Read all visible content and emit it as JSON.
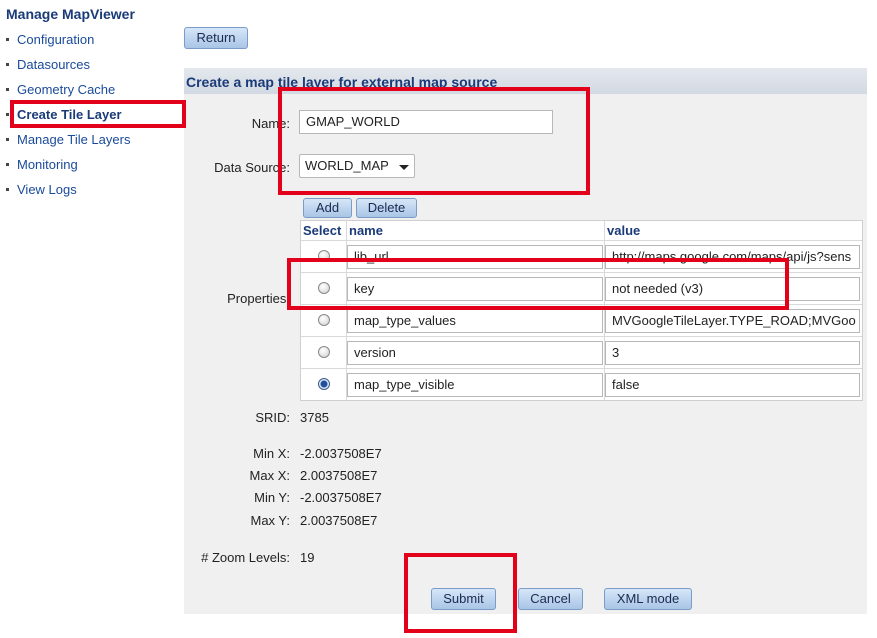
{
  "sidebar": {
    "title": "Manage MapViewer",
    "items": [
      {
        "label": "Configuration"
      },
      {
        "label": "Datasources"
      },
      {
        "label": "Geometry Cache"
      },
      {
        "label": "Create Tile Layer"
      },
      {
        "label": "Manage Tile Layers"
      },
      {
        "label": "Monitoring"
      },
      {
        "label": "View Logs"
      }
    ],
    "active_item": "Create Tile Layer"
  },
  "toolbar": {
    "return_label": "Return"
  },
  "form": {
    "title": "Create a map tile layer for external map source",
    "name_label": "Name:",
    "name_value": "GMAP_WORLD",
    "datasource_label": "Data Source:",
    "datasource_value": "WORLD_MAP",
    "properties_label": "Properties:",
    "add_label": "Add",
    "delete_label": "Delete",
    "grid_headers": {
      "select": "Select",
      "name": "name",
      "value": "value"
    },
    "properties": [
      {
        "name": "lib_url",
        "value": "http://maps.google.com/maps/api/js?sens",
        "selected": false
      },
      {
        "name": "key",
        "value": "not needed (v3)",
        "selected": false
      },
      {
        "name": "map_type_values",
        "value": "MVGoogleTileLayer.TYPE_ROAD;MVGoo",
        "selected": false
      },
      {
        "name": "version",
        "value": "3",
        "selected": false
      },
      {
        "name": "map_type_visible",
        "value": "false",
        "selected": true
      }
    ],
    "srid_label": "SRID:",
    "srid_value": "3785",
    "minx_label": "Min X:",
    "minx_value": "-2.0037508E7",
    "maxx_label": "Max X:",
    "maxx_value": "2.0037508E7",
    "miny_label": "Min Y:",
    "miny_value": "-2.0037508E7",
    "maxy_label": "Max Y:",
    "maxy_value": "2.0037508E7",
    "zoom_label": "# Zoom Levels:",
    "zoom_value": "19",
    "submit_label": "Submit",
    "cancel_label": "Cancel",
    "xml_label": "XML mode"
  },
  "colors": {
    "highlight": "#e3001b",
    "link": "#1a4a9a",
    "panel": "#f0f0f0"
  }
}
